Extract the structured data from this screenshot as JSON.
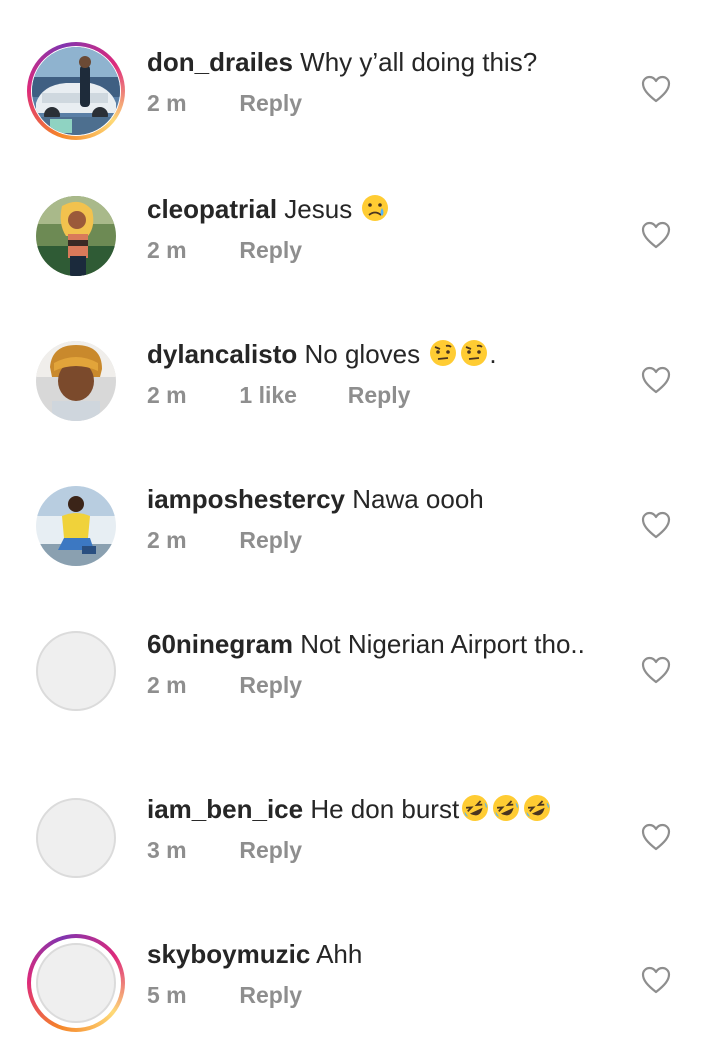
{
  "comments": [
    {
      "username": "don_drailes",
      "text": "Why y’all doing this?",
      "emojis": [],
      "time": "2 m",
      "likes": "",
      "reply_label": "Reply",
      "avatar": "photo-car",
      "has_story_ring": true
    },
    {
      "username": "cleopatrial",
      "text": "Jesus",
      "emojis": [
        "crying-face"
      ],
      "time": "2 m",
      "likes": "",
      "reply_label": "Reply",
      "avatar": "photo-woman-blonde",
      "has_story_ring": false
    },
    {
      "username": "dylancalisto",
      "text": "No gloves",
      "emojis": [
        "face-with-raised-eyebrow",
        "face-with-raised-eyebrow"
      ],
      "trailing_text": ".",
      "time": "2 m",
      "likes": "1 like",
      "reply_label": "Reply",
      "avatar": "photo-man",
      "has_story_ring": false
    },
    {
      "username": "iamposhestercy",
      "text": "Nawa oooh",
      "emojis": [],
      "time": "2 m",
      "likes": "",
      "reply_label": "Reply",
      "avatar": "photo-woman-yellow",
      "has_story_ring": false
    },
    {
      "username": "60ninegram",
      "text": "Not Nigerian Airport tho..",
      "emojis": [],
      "time": "2 m",
      "likes": "",
      "reply_label": "Reply",
      "avatar": "blank",
      "has_story_ring": false
    },
    {
      "username": "iam_ben_ice",
      "text": "He don burst",
      "emojis": [
        "rolling-on-floor-laughing",
        "rolling-on-floor-laughing",
        "rolling-on-floor-laughing"
      ],
      "time": "3 m",
      "likes": "",
      "reply_label": "Reply",
      "avatar": "blank",
      "has_story_ring": false
    },
    {
      "username": "skyboymuzic",
      "text": "Ahh",
      "emojis": [],
      "time": "5 m",
      "likes": "",
      "reply_label": "Reply",
      "avatar": "blank",
      "has_story_ring": true
    }
  ],
  "icons": {
    "like": "heart-outline-icon"
  },
  "colors": {
    "text": "#262626",
    "meta": "#8e8e8e",
    "heart": "#8e8e8e",
    "story_ring": [
      "#f58529",
      "#dd2a7b",
      "#8134af"
    ]
  }
}
